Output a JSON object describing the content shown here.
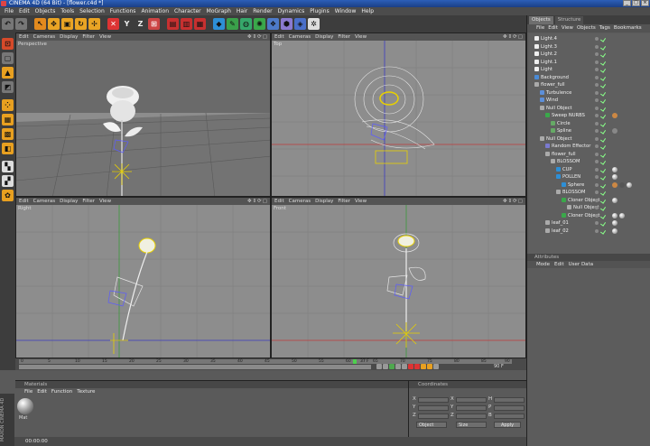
{
  "window": {
    "title": "CINEMA 4D (64 Bit) - [flower.c4d *]"
  },
  "menubar": [
    "File",
    "Edit",
    "Objects",
    "Tools",
    "Selection",
    "Functions",
    "Animation",
    "Character",
    "MoGraph",
    "Hair",
    "Render",
    "Dynamics",
    "Plugins",
    "Window",
    "Help"
  ],
  "toolbar_axis": {
    "x": "X",
    "y": "Y",
    "z": "Z"
  },
  "viewport_menu": [
    "Edit",
    "Cameras",
    "Display",
    "Filter",
    "View"
  ],
  "viewports": {
    "perspective": "Perspective",
    "top": "Top",
    "right": "Right",
    "front": "Front"
  },
  "object_manager": {
    "tabs": [
      "Objects",
      "Structure"
    ],
    "menu": [
      "File",
      "Edit",
      "View",
      "Objects",
      "Tags",
      "Bookmarks"
    ],
    "items": [
      {
        "label": "Light.4"
      },
      {
        "label": "Light.3"
      },
      {
        "label": "Light.2"
      },
      {
        "label": "Light.1"
      },
      {
        "label": "Light"
      },
      {
        "label": "Background"
      },
      {
        "label": "flower_full"
      },
      {
        "label": "Turbulence"
      },
      {
        "label": "Wind"
      },
      {
        "label": "Null Object"
      },
      {
        "label": "Sweep NURBS"
      },
      {
        "label": "Circle"
      },
      {
        "label": "Spline"
      },
      {
        "label": "Null Object"
      },
      {
        "label": "Random Effector"
      },
      {
        "label": "flower_full"
      },
      {
        "label": "BLOSSOM"
      },
      {
        "label": "CUP"
      },
      {
        "label": "POLLEN"
      },
      {
        "label": "Sphere"
      },
      {
        "label": "BLOSSOM"
      },
      {
        "label": "Cloner Object"
      },
      {
        "label": "Null Object"
      },
      {
        "label": "Cloner Object"
      },
      {
        "label": "leaf_01"
      },
      {
        "label": "leaf_02"
      }
    ]
  },
  "attributes": {
    "title": "Attributes",
    "menu": [
      "Mode",
      "Edit",
      "User Data"
    ]
  },
  "timeline": {
    "ticks": [
      "0",
      "5",
      "10",
      "15",
      "20",
      "25",
      "30",
      "35",
      "40",
      "45",
      "50",
      "55",
      "60",
      "65",
      "70",
      "75",
      "80",
      "85",
      "90"
    ],
    "current_frame": "37 F",
    "end_frame": "90 F"
  },
  "materials": {
    "title": "Materials",
    "menu": [
      "File",
      "Edit",
      "Function",
      "Texture"
    ],
    "item": "Mat"
  },
  "coordinates": {
    "title": "Coordinates",
    "rows": [
      {
        "a": "X",
        "b": "X",
        "c": "H"
      },
      {
        "a": "Y",
        "b": "Y",
        "c": "P"
      },
      {
        "a": "Z",
        "b": "Z",
        "c": "B"
      }
    ],
    "mode_left": "Object",
    "mode_mid": "Size",
    "apply": "Apply"
  },
  "status": {
    "time": "00:00:00"
  },
  "side_label": "MAXON CINEMA 4D",
  "colors": {
    "accent_yellow": "#e8d000",
    "blue_spline": "#5b5bff",
    "ui_dark": "#3d3d3d"
  }
}
